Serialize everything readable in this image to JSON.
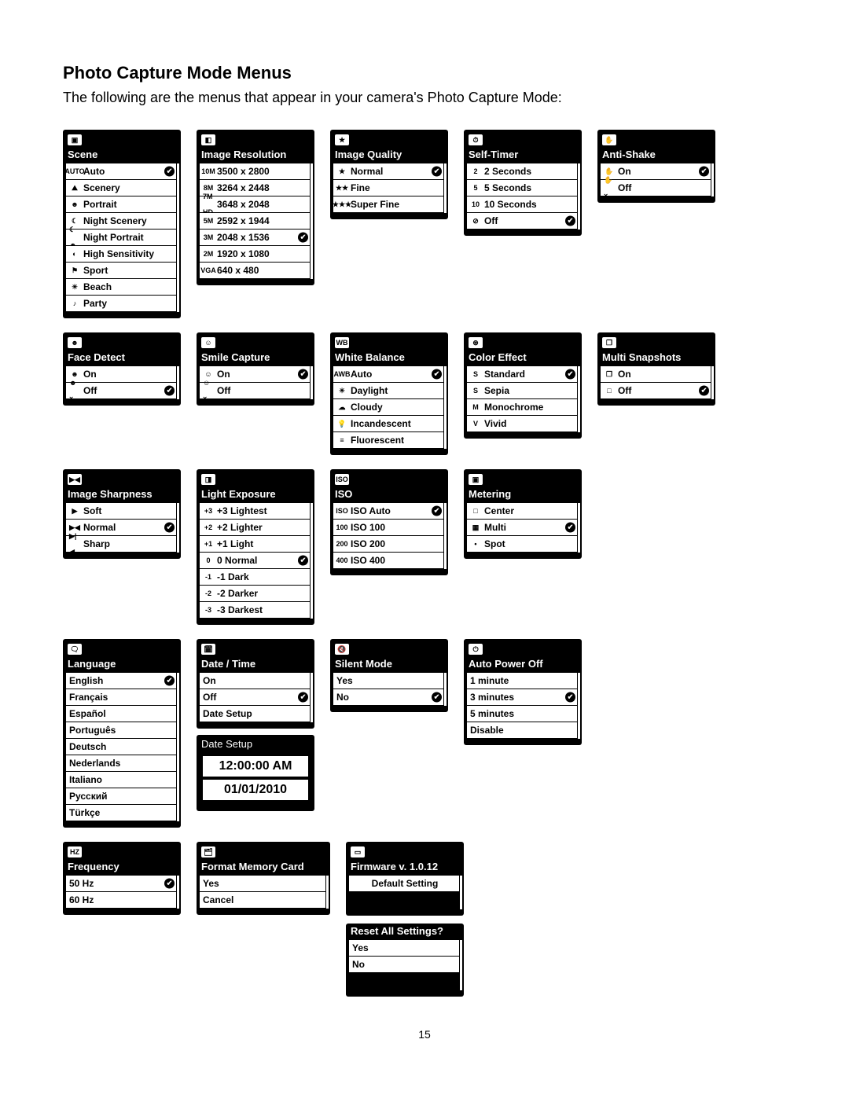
{
  "page_title": "Photo Capture Mode Menus",
  "intro": "The following are the menus that appear in your camera's Photo Capture Mode:",
  "page_number": "15",
  "date_setup": {
    "title": "Date Setup",
    "time": "12:00:00 AM",
    "date": "01/01/2010"
  },
  "firmware_extra": {
    "default_setting": "Default Setting",
    "reset_title": "Reset All Settings?",
    "reset_yes": "Yes",
    "reset_no": "No"
  },
  "rows": [
    [
      {
        "title": "Scene",
        "icon": "camera-icon",
        "glyph": "▣",
        "items": [
          {
            "label": "Auto",
            "glyph": "AUTO",
            "selected": true
          },
          {
            "label": "Scenery",
            "glyph": "⛰"
          },
          {
            "label": "Portrait",
            "glyph": "☻"
          },
          {
            "label": "Night Scenery",
            "glyph": "☾"
          },
          {
            "label": "Night Portrait",
            "glyph": "☾☻"
          },
          {
            "label": "High Sensitivity",
            "glyph": "◐"
          },
          {
            "label": "Sport",
            "glyph": "⚑"
          },
          {
            "label": "Beach",
            "glyph": "☀"
          },
          {
            "label": "Party",
            "glyph": "♪"
          }
        ]
      },
      {
        "title": "Image Resolution",
        "icon": "resolution-icon",
        "glyph": "◧",
        "items": [
          {
            "label": "3500 x 2800",
            "glyph": "10M"
          },
          {
            "label": "3264 x 2448",
            "glyph": "8M"
          },
          {
            "label": "3648 x 2048",
            "glyph": "7M HD"
          },
          {
            "label": "2592 x 1944",
            "glyph": "5M"
          },
          {
            "label": "2048 x 1536",
            "glyph": "3M",
            "selected": true
          },
          {
            "label": "1920 x 1080",
            "glyph": "2M"
          },
          {
            "label": "640 x 480",
            "glyph": "VGA"
          }
        ]
      },
      {
        "title": "Image Quality",
        "icon": "quality-icon",
        "glyph": "★",
        "items": [
          {
            "label": "Normal",
            "glyph": "★",
            "selected": true
          },
          {
            "label": "Fine",
            "glyph": "★★"
          },
          {
            "label": "Super Fine",
            "glyph": "★★★"
          }
        ]
      },
      {
        "title": "Self-Timer",
        "icon": "timer-icon",
        "glyph": "⏱",
        "items": [
          {
            "label": "2 Seconds",
            "glyph": "2"
          },
          {
            "label": "5 Seconds",
            "glyph": "5"
          },
          {
            "label": "10 Seconds",
            "glyph": "10"
          },
          {
            "label": "Off",
            "glyph": "⊘",
            "selected": true
          }
        ]
      },
      {
        "title": "Anti-Shake",
        "icon": "antishake-icon",
        "glyph": "✋",
        "items": [
          {
            "label": "On",
            "glyph": "✋",
            "selected": true
          },
          {
            "label": "Off",
            "glyph": "✋×"
          }
        ]
      }
    ],
    [
      {
        "title": "Face Detect",
        "icon": "face-icon",
        "glyph": "☻",
        "items": [
          {
            "label": "On",
            "glyph": "☻"
          },
          {
            "label": "Off",
            "glyph": "☻×",
            "selected": true
          }
        ]
      },
      {
        "title": "Smile Capture",
        "icon": "smile-icon",
        "glyph": "☺",
        "items": [
          {
            "label": "On",
            "glyph": "☺",
            "selected": true
          },
          {
            "label": "Off",
            "glyph": "☺×"
          }
        ]
      },
      {
        "title": "White Balance",
        "icon": "wb-icon",
        "glyph": "WB",
        "items": [
          {
            "label": "Auto",
            "glyph": "AWB",
            "selected": true
          },
          {
            "label": "Daylight",
            "glyph": "☀"
          },
          {
            "label": "Cloudy",
            "glyph": "☁"
          },
          {
            "label": "Incandescent",
            "glyph": "💡"
          },
          {
            "label": "Fluorescent",
            "glyph": "≡"
          }
        ]
      },
      {
        "title": "Color Effect",
        "icon": "coloreffect-icon",
        "glyph": "⊛",
        "items": [
          {
            "label": "Standard",
            "glyph": "S",
            "selected": true
          },
          {
            "label": "Sepia",
            "glyph": "S"
          },
          {
            "label": "Monochrome",
            "glyph": "M"
          },
          {
            "label": "Vivid",
            "glyph": "V"
          }
        ]
      },
      {
        "title": "Multi Snapshots",
        "icon": "multisnap-icon",
        "glyph": "❐",
        "items": [
          {
            "label": "On",
            "glyph": "❐"
          },
          {
            "label": "Off",
            "glyph": "□",
            "selected": true
          }
        ]
      }
    ],
    [
      {
        "title": "Image Sharpness",
        "icon": "sharpness-icon",
        "glyph": "▶◀",
        "items": [
          {
            "label": "Soft",
            "glyph": "▶"
          },
          {
            "label": "Normal",
            "glyph": "▶◀",
            "selected": true
          },
          {
            "label": "Sharp",
            "glyph": "▶|◀"
          }
        ]
      },
      {
        "title": "Light Exposure",
        "icon": "exposure-icon",
        "glyph": "◨",
        "items": [
          {
            "label": "+3 Lightest",
            "glyph": "+3"
          },
          {
            "label": "+2 Lighter",
            "glyph": "+2"
          },
          {
            "label": "+1 Light",
            "glyph": "+1"
          },
          {
            "label": "0 Normal",
            "glyph": "0",
            "selected": true
          },
          {
            "label": "-1 Dark",
            "glyph": "-1"
          },
          {
            "label": "-2 Darker",
            "glyph": "-2"
          },
          {
            "label": "-3 Darkest",
            "glyph": "-3"
          }
        ]
      },
      {
        "title": "ISO",
        "icon": "iso-icon",
        "glyph": "ISO",
        "items": [
          {
            "label": "ISO Auto",
            "glyph": "ISO",
            "selected": true
          },
          {
            "label": "ISO 100",
            "glyph": "100"
          },
          {
            "label": "ISO 200",
            "glyph": "200"
          },
          {
            "label": "ISO 400",
            "glyph": "400"
          }
        ]
      },
      {
        "title": "Metering",
        "icon": "metering-icon",
        "glyph": "▣",
        "items": [
          {
            "label": "Center",
            "glyph": "□"
          },
          {
            "label": "Multi",
            "glyph": "▦",
            "selected": true
          },
          {
            "label": "Spot",
            "glyph": "•"
          }
        ]
      }
    ],
    [
      {
        "title": "Language",
        "icon": "language-icon",
        "glyph": "🗨",
        "items": [
          {
            "label": "English",
            "selected": true
          },
          {
            "label": "Français"
          },
          {
            "label": "Español"
          },
          {
            "label": "Português"
          },
          {
            "label": "Deutsch"
          },
          {
            "label": "Nederlands"
          },
          {
            "label": "Italiano"
          },
          {
            "label": "Русский"
          },
          {
            "label": "Türkçe"
          }
        ]
      },
      {
        "title": "Date / Time",
        "icon": "datetime-icon",
        "glyph": "🗓",
        "has_date_popup": true,
        "items": [
          {
            "label": "On"
          },
          {
            "label": "Off",
            "selected": true
          },
          {
            "label": "Date Setup"
          }
        ]
      },
      {
        "title": "Silent Mode",
        "icon": "silent-icon",
        "glyph": "🔇",
        "items": [
          {
            "label": "Yes"
          },
          {
            "label": "No",
            "selected": true
          }
        ]
      },
      {
        "title": "Auto Power Off",
        "icon": "power-icon",
        "glyph": "⏻",
        "items": [
          {
            "label": "1 minute"
          },
          {
            "label": "3 minutes",
            "selected": true
          },
          {
            "label": "5 minutes"
          },
          {
            "label": "Disable"
          }
        ]
      }
    ],
    [
      {
        "title": "Frequency",
        "icon": "frequency-icon",
        "glyph": "HZ",
        "items": [
          {
            "label": "50 Hz",
            "selected": true
          },
          {
            "label": "60 Hz"
          }
        ]
      },
      {
        "title": "Format Memory Card",
        "icon": "format-icon",
        "glyph": "🗂",
        "wide": true,
        "items": [
          {
            "label": "Yes"
          },
          {
            "label": "Cancel"
          }
        ]
      },
      {
        "title": "Firmware v. 1.0.12",
        "icon": "firmware-icon",
        "glyph": "▭",
        "is_firmware": true,
        "items": []
      }
    ]
  ]
}
